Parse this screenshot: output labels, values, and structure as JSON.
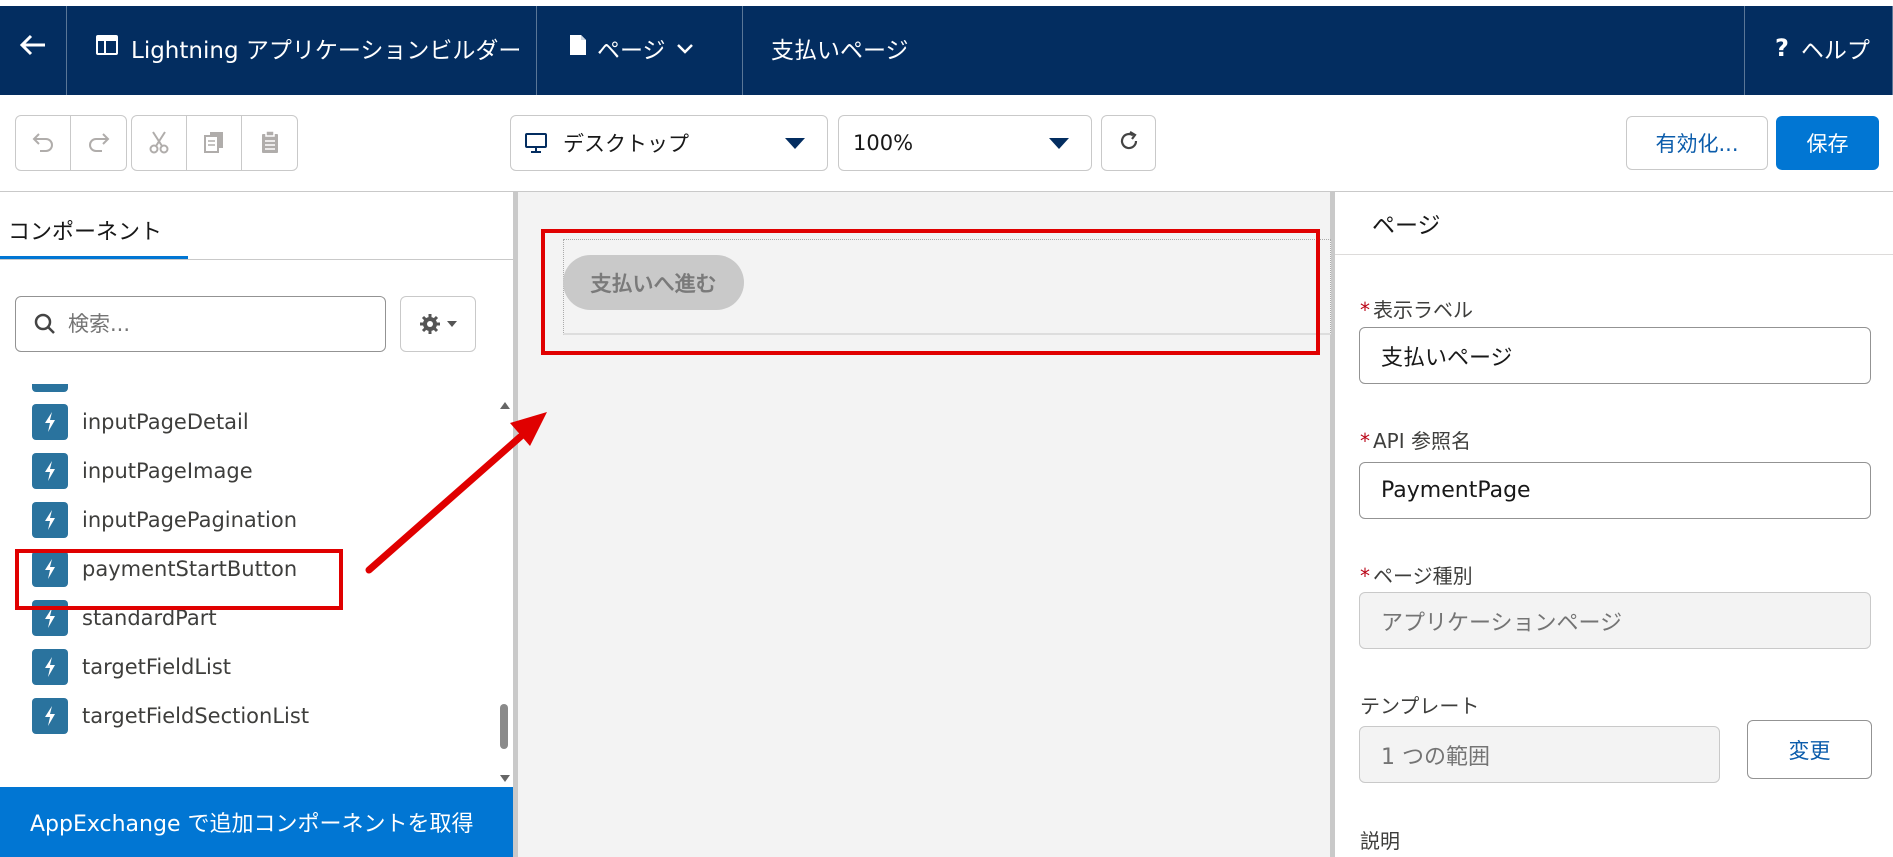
{
  "header": {
    "back_icon": "arrow-left-icon",
    "app_icon": "app-builder-icon",
    "app_title": "Lightning アプリケーションビルダー",
    "page_menu_icon": "document-icon",
    "page_menu_label": "ページ",
    "page_title": "支払いページ",
    "help_label": "ヘルプ"
  },
  "toolbar": {
    "undo_icon": "undo-icon",
    "redo_icon": "redo-icon",
    "cut_icon": "cut-icon",
    "copy_icon": "copy-icon",
    "paste_icon": "paste-icon",
    "device_select": "デスクトップ",
    "zoom_select": "100%",
    "refresh_icon": "refresh-icon",
    "activate_label": "有効化...",
    "save_label": "保存"
  },
  "components_panel": {
    "tab_label": "コンポーネント",
    "search_placeholder": "検索...",
    "items": [
      {
        "label": "inputPageDetail"
      },
      {
        "label": "inputPageImage"
      },
      {
        "label": "inputPagePagination"
      },
      {
        "label": "paymentStartButton"
      },
      {
        "label": "standardPart"
      },
      {
        "label": "targetFieldList"
      },
      {
        "label": "targetFieldSectionList"
      }
    ],
    "appexchange_label": "AppExchange で追加コンポーネントを取得"
  },
  "canvas": {
    "payment_button_label": "支払いへ進む"
  },
  "properties_panel": {
    "title": "ページ",
    "label_field": {
      "label": "表示ラベル",
      "value": "支払いページ",
      "required": "*"
    },
    "api_field": {
      "label": "API 参照名",
      "value": "PaymentPage",
      "required": "*"
    },
    "type_field": {
      "label": "ページ種別",
      "value": "アプリケーションページ",
      "required": "*"
    },
    "template_field": {
      "label": "テンプレート",
      "value": "1 つの範囲",
      "change_label": "変更"
    },
    "description_label": "説明"
  },
  "colors": {
    "header_bg": "#032d60",
    "brand_blue": "#0176d3",
    "annotation_red": "#e00000",
    "component_icon": "#2a739e"
  }
}
